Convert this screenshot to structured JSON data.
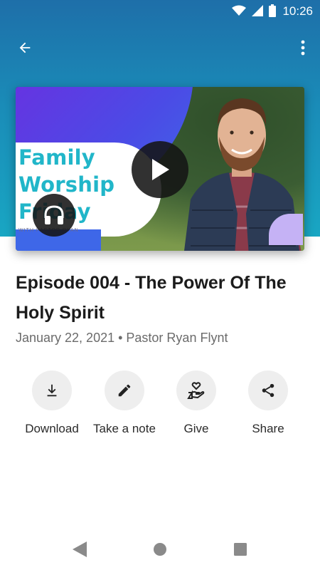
{
  "status_bar": {
    "time": "10:26",
    "icons": [
      "wifi-icon",
      "signal-icon",
      "battery-icon"
    ]
  },
  "app_bar": {
    "back_icon": "arrow-back-icon",
    "more_icon": "more-vert-icon"
  },
  "thumbnail": {
    "title_lines": [
      "Family",
      "Worship",
      "Friday"
    ],
    "subtitle": "WITH PASTOR RYAN",
    "play_icon": "play-icon",
    "audio_icon": "headphones-icon"
  },
  "episode": {
    "title": "Episode 004 - The Power Of The Holy Spirit",
    "meta": "January 22, 2021 • Pastor Ryan Flynt"
  },
  "actions": [
    {
      "label": "Download",
      "icon": "download-icon"
    },
    {
      "label": "Take a note",
      "icon": "pencil-icon"
    },
    {
      "label": "Give",
      "icon": "give-hand-heart-icon"
    },
    {
      "label": "Share",
      "icon": "share-icon"
    }
  ],
  "nav": {
    "back": "nav-back-icon",
    "home": "nav-home-icon",
    "recents": "nav-recents-icon"
  },
  "colors": {
    "header_top": "#1e6fa9",
    "header_bottom": "#19a6c3",
    "thumb_title": "#21b6c9",
    "accent_purple": "#6b2fe0"
  }
}
